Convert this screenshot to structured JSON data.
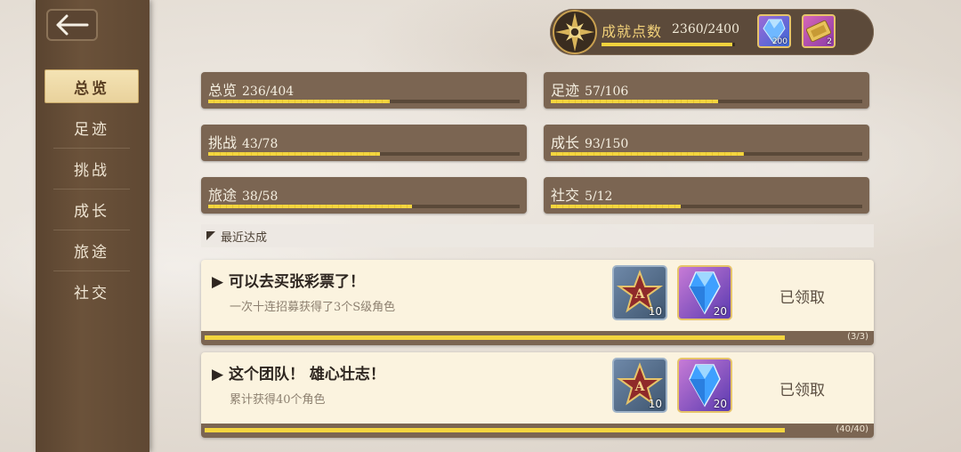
{
  "nav": {
    "back_label": "←",
    "items": [
      {
        "label": "总览"
      },
      {
        "label": "足迹"
      },
      {
        "label": "挑战"
      },
      {
        "label": "成长"
      },
      {
        "label": "旅途"
      },
      {
        "label": "社交"
      }
    ],
    "active_index": 0
  },
  "points": {
    "label": "成就点数",
    "value": "2360/2400",
    "progress": 0.983,
    "rewards": [
      {
        "icon": "blue-crystal-icon",
        "count": "200"
      },
      {
        "icon": "gold-ticket-icon",
        "count": "2"
      }
    ]
  },
  "categories": [
    {
      "name": "总览",
      "value": "236/404",
      "progress": 0.584
    },
    {
      "name": "足迹",
      "value": "57/106",
      "progress": 0.538
    },
    {
      "name": "挑战",
      "value": "43/78",
      "progress": 0.551
    },
    {
      "name": "成长",
      "value": "93/150",
      "progress": 0.62
    },
    {
      "name": "旅途",
      "value": "38/58",
      "progress": 0.655
    },
    {
      "name": "社交",
      "value": "5/12",
      "progress": 0.417
    }
  ],
  "recent": {
    "header": "最近达成",
    "items": [
      {
        "title": "▶ 可以去买张彩票了！",
        "desc": "一次十连招募获得了3个S级角色",
        "rewards": [
          {
            "icon": "a-rank-star-icon",
            "count": "10"
          },
          {
            "icon": "blue-crystal-icon",
            "count": "20"
          }
        ],
        "status": "已领取",
        "count": "(3/3)",
        "progress": 1.0
      },
      {
        "title": "▶ 这个团队！ 雄心壮志！",
        "desc": "累计获得40个角色",
        "rewards": [
          {
            "icon": "a-rank-star-icon",
            "count": "10"
          },
          {
            "icon": "blue-crystal-icon",
            "count": "20"
          }
        ],
        "status": "已领取",
        "count": "(40/40)",
        "progress": 1.0
      }
    ]
  },
  "colors": {
    "accent_gold": "#f3d53f",
    "panel_brown": "#7b6552",
    "sidebar_brown": "#5f4833"
  }
}
